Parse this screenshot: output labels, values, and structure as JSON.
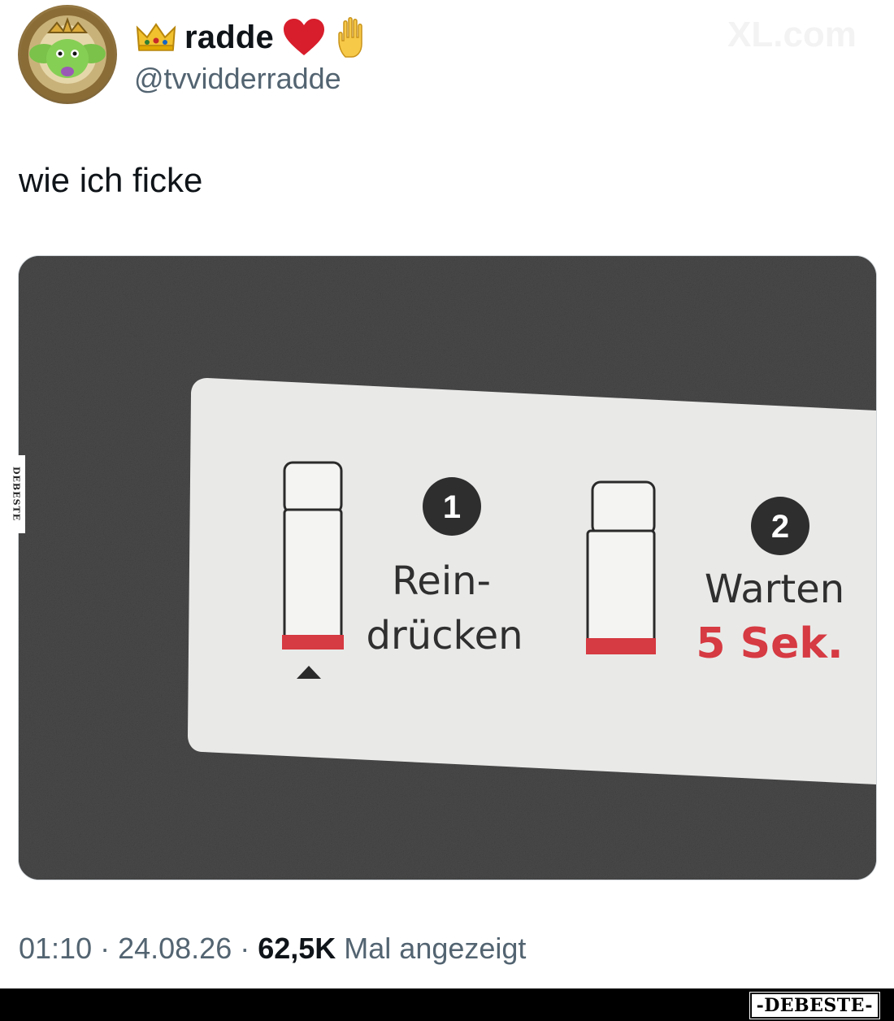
{
  "tweet": {
    "display_name": "radde",
    "handle": "@tvvidderradde",
    "name_emojis": [
      "crown-icon",
      "red-heart-icon",
      "raised-hand-icon"
    ],
    "text": "wie ich ficke",
    "timestamp": "01:10 · 24.08.26 · ",
    "views_count": "62,5K",
    "views_label": " Mal angezeigt"
  },
  "media": {
    "step1_number": "1",
    "step1_line1": "Rein-",
    "step1_line2": "drücken",
    "step2_number": "2",
    "step2_line1": "Warten",
    "step2_line2": "5 Sek.",
    "accent_red": "#d63a42",
    "label_bg": "#e9eae8"
  },
  "watermarks": {
    "top": "XL.com",
    "side": "DEBESTE",
    "footer": "-DEBESTE-"
  }
}
